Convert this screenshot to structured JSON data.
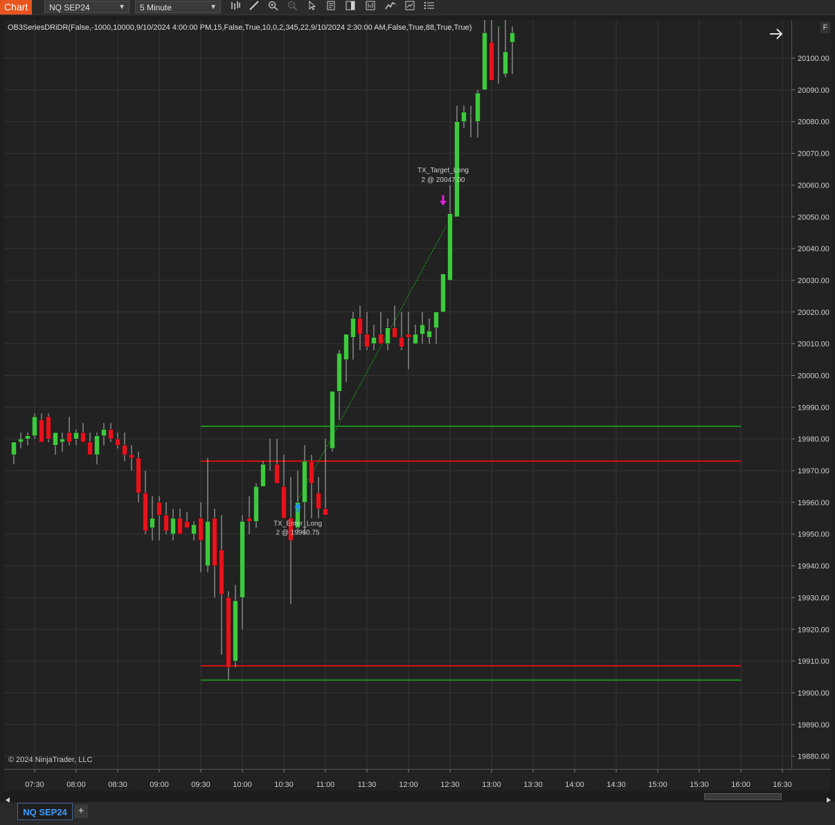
{
  "toolbar": {
    "chart_label": "Chart",
    "instrument": "NQ SEP24",
    "interval": "5 Minute",
    "icons": [
      "bar-type-icon",
      "drawing-tool-icon",
      "zoom-in-icon",
      "zoom-out-icon",
      "pointer-icon",
      "properties-icon",
      "chart-trader-icon",
      "data-box-icon",
      "indicators-icon",
      "strategies-icon",
      "menu-icon"
    ]
  },
  "chart": {
    "indicator_label": "OB3SeriesDRiDR(False,-1000,10000,9/10/2024 4:00:00 PM,15,False,True,10,0,2,345,22,9/10/2024 2:30:00 AM,False,True,88,True,True)",
    "copyright": "© 2024 NinjaTrader, LLC",
    "corner_button": "F",
    "colors": {
      "up": "#3ec93e",
      "down": "#e8121c",
      "wick": "#bbbbbb",
      "grid": "#353535",
      "green_level": "#1f8f1f",
      "red_level": "#e01010",
      "entry_arrow": "#1e90ff",
      "target_arrow": "#e020e0",
      "background": "#222222"
    },
    "price_ticks": [
      "20100.00",
      "20090.00",
      "20080.00",
      "20070.00",
      "20060.00",
      "20050.00",
      "20040.00",
      "20030.00",
      "20020.00",
      "20010.00",
      "20000.00",
      "19990.00",
      "19980.00",
      "19970.00",
      "19960.00",
      "19950.00",
      "19940.00",
      "19930.00",
      "19920.00",
      "19910.00",
      "19900.00",
      "19890.00",
      "19880.00"
    ],
    "time_ticks": [
      "07:30",
      "08:00",
      "08:30",
      "09:00",
      "09:30",
      "10:00",
      "10:30",
      "11:00",
      "11:30",
      "12:00",
      "12:30",
      "13:00",
      "13:30",
      "14:00",
      "14:30",
      "15:00",
      "15:30",
      "16:00",
      "16:30"
    ],
    "levels": [
      {
        "price": 19984,
        "color": "green",
        "from": "09:30",
        "to": "16:00"
      },
      {
        "price": 19973,
        "color": "red",
        "from": "09:30",
        "to": "16:00"
      },
      {
        "price": 19908.5,
        "color": "red",
        "from": "09:30",
        "to": "16:00"
      },
      {
        "price": 19904,
        "color": "green",
        "from": "09:30",
        "to": "16:00"
      }
    ],
    "entry": {
      "label": "TX_Enter_Long",
      "detail": "2 @ 19960.75",
      "time": "10:40",
      "price": 19960.75
    },
    "target": {
      "label": "TX_Target_Long",
      "detail": "2 @ 20047.00",
      "time": "12:25",
      "price": 20047
    }
  },
  "chart_data": {
    "type": "candlestick",
    "bar_interval": "5 Minute",
    "times": [
      "07:15",
      "07:20",
      "07:25",
      "07:30",
      "07:35",
      "07:40",
      "07:45",
      "07:50",
      "07:55",
      "08:00",
      "08:05",
      "08:10",
      "08:15",
      "08:20",
      "08:25",
      "08:30",
      "08:35",
      "08:40",
      "08:45",
      "08:50",
      "08:55",
      "09:00",
      "09:05",
      "09:10",
      "09:15",
      "09:20",
      "09:25",
      "09:30",
      "09:35",
      "09:40",
      "09:45",
      "09:50",
      "09:55",
      "10:00",
      "10:05",
      "10:10",
      "10:15",
      "10:20",
      "10:25",
      "10:30",
      "10:35",
      "10:40",
      "10:45",
      "10:50",
      "10:55",
      "11:00",
      "11:05",
      "11:10",
      "11:15",
      "11:20",
      "11:25",
      "11:30",
      "11:35",
      "11:40",
      "11:45",
      "11:50",
      "11:55",
      "12:00",
      "12:05",
      "12:10",
      "12:15",
      "12:20",
      "12:25",
      "12:30",
      "12:35",
      "12:40",
      "12:45",
      "12:50",
      "12:55",
      "13:00",
      "13:05",
      "13:10",
      "13:15"
    ],
    "open": [
      19975,
      19979,
      19980,
      19981,
      19986,
      19987,
      19978,
      19979,
      19982,
      19980,
      19982,
      19979,
      19975,
      19981,
      19983,
      19980,
      19978,
      19975,
      19974,
      19963,
      19952,
      19960,
      19956,
      19950,
      19955,
      19954,
      19950,
      19955,
      19940,
      19955,
      19945,
      19930,
      19910,
      19930,
      19955,
      19954,
      19965,
      19972,
      19972,
      19965,
      19955,
      19952,
      19960,
      19973,
      19963,
      19958,
      19977,
      19995,
      20005,
      20012,
      20018,
      20013,
      20010,
      20013,
      20010,
      20015,
      20012,
      20013,
      20010,
      20013,
      20012,
      20015,
      20020,
      20030,
      20050,
      20080,
      20082,
      20080,
      20090,
      20105,
      20110,
      20095,
      20105
    ],
    "high": [
      19978,
      19982,
      19982,
      19988,
      19988,
      19988,
      19982,
      19982,
      19987,
      19983,
      19985,
      19982,
      19982,
      19985,
      19985,
      19982,
      19982,
      19978,
      19976,
      19970,
      19962,
      19962,
      19960,
      19958,
      19958,
      19957,
      19954,
      19960,
      19974,
      19958,
      19956,
      19932,
      19934,
      19956,
      19962,
      19966,
      19973,
      19980,
      19980,
      19975,
      19968,
      19970,
      19978,
      19975,
      19968,
      19980,
      19992,
      20008,
      20012,
      20020,
      20022,
      20020,
      20016,
      20020,
      20018,
      20022,
      20020,
      20020,
      20016,
      20020,
      20018,
      20020,
      20030,
      20060,
      20085,
      20085,
      20085,
      20090,
      20115,
      20120,
      20110,
      20115,
      20110
    ],
    "low": [
      19972,
      19977,
      19978,
      19980,
      19982,
      19979,
      19975,
      19976,
      19978,
      19978,
      19979,
      19975,
      19972,
      19978,
      19979,
      19977,
      19973,
      19970,
      19960,
      19950,
      19948,
      19948,
      19950,
      19948,
      19950,
      19952,
      19948,
      19938,
      19938,
      19930,
      19912,
      19904,
      19908,
      19920,
      19950,
      19952,
      19965,
      19970,
      19966,
      19955,
      19928,
      19950,
      19950,
      19955,
      19955,
      19957,
      19976,
      19986,
      19998,
      20005,
      20008,
      20008,
      20008,
      20010,
      20008,
      20012,
      20008,
      20002,
      20010,
      20010,
      20010,
      20010,
      20028,
      20045,
      20070,
      20078,
      20075,
      20075,
      20090,
      20100,
      20092,
      20094,
      20095
    ],
    "close": [
      19979,
      19980,
      19981,
      19987,
      19979,
      19980,
      19982,
      19980,
      19979,
      19982,
      19979,
      19975,
      19981,
      19983,
      19980,
      19978,
      19975,
      19974,
      19963,
      19951,
      19955,
      19956,
      19951,
      19955,
      19950,
      19952,
      19953,
      19948,
      19954,
      19940,
      19931,
      19908,
      19929,
      19954,
      19954,
      19965,
      19972,
      19972,
      19966,
      19955,
      19948,
      19960,
      19973,
      19966,
      19958,
      19956,
      19995,
      20007,
      20013,
      20018,
      20013,
      20009,
      20012,
      20010,
      20015,
      20012,
      20009,
      20012,
      20013,
      20016,
      20014,
      20020,
      20032,
      20051,
      20080,
      20083,
      20082,
      20089,
      20108,
      20093,
      20110,
      20102,
      20108
    ],
    "ylim": [
      19876,
      20112
    ],
    "xlim": [
      "07:20",
      "16:40"
    ]
  }
}
